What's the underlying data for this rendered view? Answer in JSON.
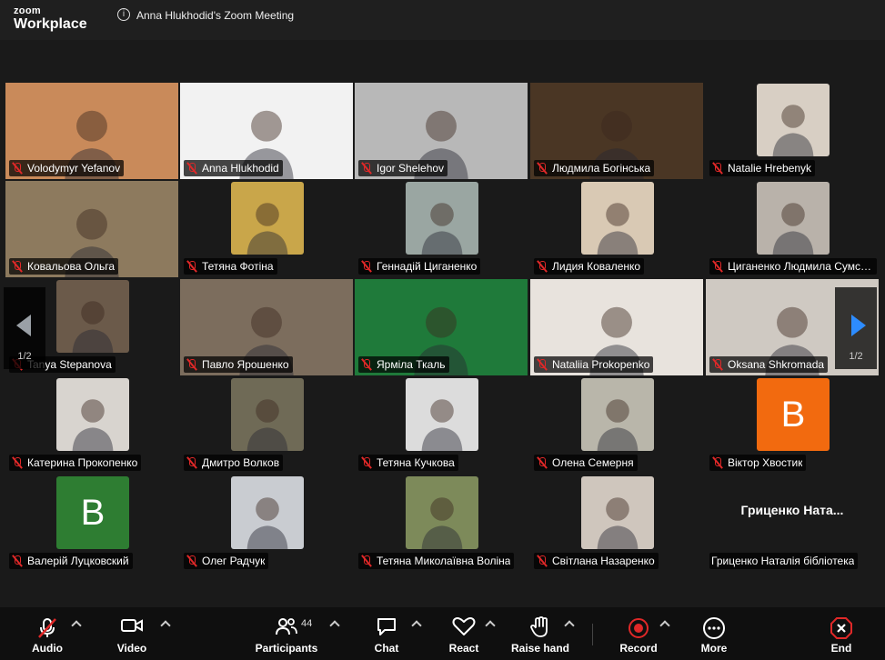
{
  "app": {
    "logo_top": "zoom",
    "logo_bottom": "Workplace",
    "info_glyph": "i",
    "meeting_title": "Anna Hlukhodid's Zoom Meeting"
  },
  "pagination": {
    "left_label": "1/2",
    "right_label": "1/2"
  },
  "participants": [
    {
      "name": "Volodymyr Yefanov",
      "bg": "#c98a5a"
    },
    {
      "name": "Anna Hlukhodid",
      "bg": "#f2f2f2"
    },
    {
      "name": "Igor Shelehov",
      "bg": "#b8b8b8"
    },
    {
      "name": "Людмила Богінська",
      "bg": "#4a3624"
    },
    {
      "name": "Natalie Hrebenyk",
      "bg": "#d8cfc4"
    },
    {
      "name": "Ковальова Ольга",
      "bg": "#8d7a5e"
    },
    {
      "name": "Тетяна Фотіна",
      "bg": "#c9a64a"
    },
    {
      "name": "Геннадій Циганенко",
      "bg": "#9aa6a2"
    },
    {
      "name": "Лидия Коваленко",
      "bg": "#d9c9b4"
    },
    {
      "name": "Циганенко Людмила Сумськи",
      "bg": "#b9b2aa"
    },
    {
      "name": "Tanya Stepanova",
      "bg": "#6b5a4a"
    },
    {
      "name": "Павло Ярошенко",
      "bg": "#7c6d5d"
    },
    {
      "name": "Ярміла Ткаль",
      "bg": "#1f7a3a"
    },
    {
      "name": "Nataliia Prokopenko",
      "bg": "#e8e3dd"
    },
    {
      "name": "Oksana Shkromada",
      "bg": "#cfc9c2"
    },
    {
      "name": "Катерина Прокопенко",
      "bg": "#d8d4cf"
    },
    {
      "name": "Дмитро Волков",
      "bg": "#6f6a56"
    },
    {
      "name": "Тетяна Кучкова",
      "bg": "#dcdcdc"
    },
    {
      "name": "Олена Семерня",
      "bg": "#b9b6aa"
    },
    {
      "name": "Віктор Хвостик",
      "letter": "B",
      "bg": "#f26a0f"
    },
    {
      "name": "Валерій Луцковский",
      "letter": "B",
      "bg": "#2e7d32"
    },
    {
      "name": "Олег Радчук",
      "bg": "#c9ccd1"
    },
    {
      "name": "Тетяна Миколаївна Воліна",
      "bg": "#7d8a5a"
    },
    {
      "name": "Світлана Назаренко",
      "bg": "#cfc6bd"
    },
    {
      "name": "Гриценко Наталія бібліотека",
      "big_name": "Гриценко  Ната..."
    }
  ],
  "toolbar": {
    "audio": "Audio",
    "video": "Video",
    "participants": "Participants",
    "participants_count": "44",
    "chat": "Chat",
    "react": "React",
    "raise_hand": "Raise hand",
    "record": "Record",
    "more": "More",
    "end": "End"
  }
}
